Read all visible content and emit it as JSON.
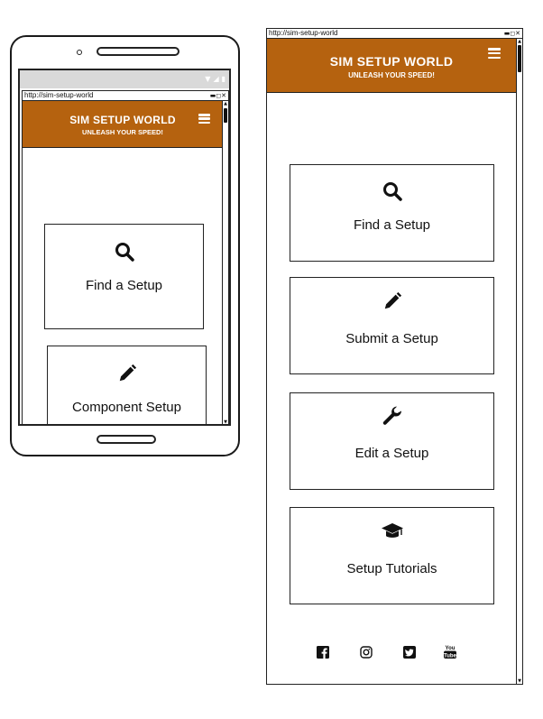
{
  "mobile": {
    "url": "http://sim-setup-world",
    "window_controls": "▬◻✕",
    "header": {
      "title": "SIM SETUP WORLD",
      "tagline": "UNLEASH YOUR SPEED!"
    },
    "cards": [
      {
        "label": "Find a Setup",
        "icon": "search-icon"
      },
      {
        "label": "Component Setup",
        "icon": "pencil-icon"
      }
    ]
  },
  "desktop": {
    "url": "http://sim-setup-world",
    "window_controls": "▬◻✕",
    "header": {
      "title": "SIM SETUP WORLD",
      "tagline": "UNLEASH YOUR SPEED!"
    },
    "cards": [
      {
        "label": "Find a Setup",
        "icon": "search-icon"
      },
      {
        "label": "Submit a Setup",
        "icon": "pencil-icon"
      },
      {
        "label": "Edit a Setup",
        "icon": "wrench-icon"
      },
      {
        "label": "Setup Tutorials",
        "icon": "graduation-cap-icon"
      }
    ],
    "social": [
      {
        "icon": "facebook-icon"
      },
      {
        "icon": "instagram-icon"
      },
      {
        "icon": "twitter-icon"
      },
      {
        "icon": "youtube-icon"
      }
    ]
  },
  "colors": {
    "header_bg": "#b5620f",
    "header_text": "#ffffff",
    "outline": "#222222"
  }
}
